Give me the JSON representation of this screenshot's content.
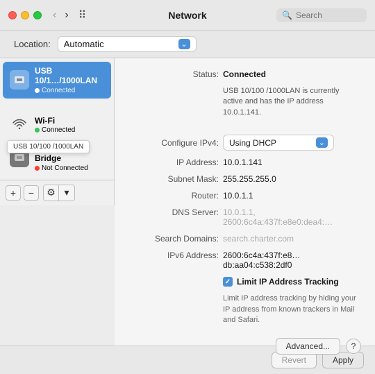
{
  "titlebar": {
    "title": "Network",
    "search_placeholder": "Search",
    "nav": {
      "back_label": "‹",
      "forward_label": "›",
      "grid_label": "⠿"
    }
  },
  "location": {
    "label": "Location:",
    "value": "Automatic"
  },
  "sidebar": {
    "items": [
      {
        "id": "usb",
        "name": "USB 10/1…/1000LAN",
        "status": "Connected",
        "status_type": "green",
        "active": true,
        "icon": "🔌"
      },
      {
        "id": "wifi",
        "name": "Wi-Fi",
        "status": "Connected",
        "status_type": "green",
        "active": false,
        "icon": "📶"
      },
      {
        "id": "thunderbolt",
        "name": "Thunderbolt Bridge",
        "status": "Not Connected",
        "status_type": "red",
        "active": false,
        "icon": "⚡"
      }
    ],
    "tooltip": "USB 10/100 /1000LAN",
    "footer": {
      "add_label": "+",
      "remove_label": "−",
      "menu_label": "⚙",
      "arrow_label": "▾"
    }
  },
  "detail": {
    "status_label": "Status:",
    "status_value": "Connected",
    "status_desc": "USB 10/100 /1000LAN is currently active and has the IP address 10.0.1.141.",
    "configure_label": "Configure IPv4:",
    "configure_value": "Using DHCP",
    "ip_label": "IP Address:",
    "ip_value": "10.0.1.141",
    "subnet_label": "Subnet Mask:",
    "subnet_value": "255.255.255.0",
    "router_label": "Router:",
    "router_value": "10.0.1.1",
    "dns_label": "DNS Server:",
    "dns_value": "10.0.1.1, 2600:6c4a:437f:e8e0:dea4:…",
    "search_label": "Search Domains:",
    "search_value": "search.charter.com",
    "ipv6_label": "IPv6 Address:",
    "ipv6_value": "2600:6c4a:437f:e8…db:aa04:c538:2df0",
    "limit_ip_label": "Limit IP Address Tracking",
    "limit_ip_desc": "Limit IP address tracking by hiding your IP address from known trackers in Mail and Safari.",
    "advanced_label": "Advanced...",
    "help_label": "?",
    "revert_label": "Revert",
    "apply_label": "Apply"
  }
}
